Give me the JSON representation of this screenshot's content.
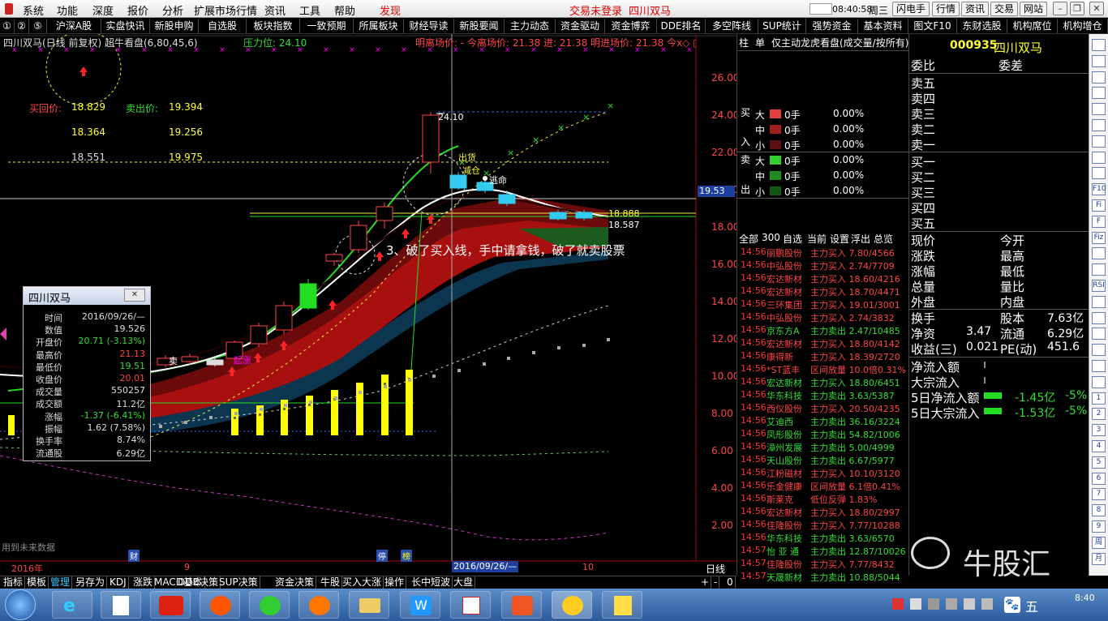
{
  "menu": {
    "items": [
      "系统",
      "功能",
      "深度",
      "报价",
      "分析",
      "扩展市场行情",
      "资讯",
      "工具",
      "帮助"
    ],
    "discover": "发现",
    "login_status": "交易未登录",
    "stock_title": "四川双马",
    "clock": "08:40:58",
    "weekday": "周三",
    "buttons": [
      "闪电手",
      "行情",
      "资讯",
      "交易",
      "网站"
    ]
  },
  "tabs": [
    "①",
    "②",
    "⑤",
    "沪深A股",
    "实盘快讯",
    "新股申购",
    "自选股",
    "板块指数",
    "一致预期",
    "所属板块",
    "财经导读",
    "新股要闻",
    "主力动态",
    "资金驱动",
    "资金博弈",
    "DDE排名",
    "多空阵线",
    "SUP统计",
    "强势资金",
    "基本资料",
    "图文F10",
    "东财选股",
    "机构席位",
    "机构增仓"
  ],
  "chart": {
    "header": {
      "name": "四川双马(日线 前复权) 超牛看盘(6,80,45,6)",
      "pressure": "压力位: 24.10",
      "signal": "明离场价: - 今离场价: 21.38 进: 21.38 明进场价: 21.38 今x◇ □"
    },
    "prices": [
      {
        "label": "买回价:",
        "buy": "18.829",
        "sell_label": "卖出价:",
        "sell": "19.394"
      },
      {
        "label": "",
        "buy": "18.364",
        "sell_label": "",
        "sell": "19.256"
      },
      {
        "label": "",
        "buy": "18.551",
        "sell_label": "",
        "sell": "19.975"
      }
    ],
    "price_axis": [
      "26.00",
      "24.00",
      "22.00",
      "20.00",
      "18.00",
      "16.00",
      "14.00",
      "12.00",
      "10.00",
      "8.00",
      "6.00",
      "4.00",
      "2.00"
    ],
    "cursor_price": "19.53",
    "annotation": "3、破了买入线，手中请拿钱，破了就卖股票",
    "labels": {
      "high": "24.10",
      "right1": "18.888",
      "right2": "18.587",
      "chu": "出货",
      "jian": "减仓",
      "tao": "逃命",
      "qi": "起涨",
      "mai": "卖",
      "watermark": "用到未来数据"
    },
    "date_axis": {
      "year": "2016年",
      "m9": "9",
      "m10": "10",
      "cursor_date": "2016/09/26/—",
      "cai1": "财",
      "cai2": "停",
      "cai3": "榜",
      "period": "日线"
    }
  },
  "infobox": {
    "title": "四川双马",
    "close": "✕",
    "rows": [
      {
        "k": "时间",
        "v": "2016/09/26/—",
        "c": "#ddd"
      },
      {
        "k": "数值",
        "v": "19.526",
        "c": "#ddd"
      },
      {
        "k": "开盘价",
        "v": "20.71 (-3.13%)",
        "c": "#3d3"
      },
      {
        "k": "最高价",
        "v": "21.13",
        "c": "#f44"
      },
      {
        "k": "最低价",
        "v": "19.51",
        "c": "#3d3"
      },
      {
        "k": "收盘价",
        "v": "20.01",
        "c": "#f44"
      },
      {
        "k": "成交量",
        "v": "550257",
        "c": "#ddd"
      },
      {
        "k": "成交额",
        "v": "11.2亿",
        "c": "#ddd"
      },
      {
        "k": "涨幅",
        "v": "-1.37 (-6.41%)",
        "c": "#3d3"
      },
      {
        "k": "振幅",
        "v": "1.62 (7.58%)",
        "c": "#ddd"
      },
      {
        "k": "换手率",
        "v": "8.74%",
        "c": "#ddd"
      },
      {
        "k": "流通股",
        "v": "6.29亿",
        "c": "#ddd"
      }
    ]
  },
  "mid": {
    "tabs": [
      "柱",
      "单",
      "仅主动",
      "龙虎看盘(成交量/按所有)"
    ],
    "flow_sides": [
      "买",
      "入",
      "卖",
      "出"
    ],
    "flow": [
      {
        "size": "大",
        "vol": "0手",
        "pct": "0.00%",
        "color": "#e04040"
      },
      {
        "size": "中",
        "vol": "0手",
        "pct": "0.00%",
        "color": "#a01e1e"
      },
      {
        "size": "小",
        "vol": "0手",
        "pct": "0.00%",
        "color": "#5a1010"
      },
      {
        "size": "大",
        "vol": "0手",
        "pct": "0.00%",
        "color": "#33cc33"
      },
      {
        "size": "中",
        "vol": "0手",
        "pct": "0.00%",
        "color": "#1e8c1e"
      },
      {
        "size": "小",
        "vol": "0手",
        "pct": "0.00%",
        "color": "#125812"
      }
    ],
    "filter": [
      "全部",
      "300",
      "自选",
      "当前",
      "设置",
      "浮出",
      "总览"
    ],
    "ticker": [
      {
        "t": "14:56",
        "n": "丽鹏股份",
        "d": "主力买入 7.80/4566",
        "c": "#f44"
      },
      {
        "t": "14:56",
        "n": "中弘股份",
        "d": "主力买入 2.74/7709",
        "c": "#f44"
      },
      {
        "t": "14:56",
        "n": "宏达新材",
        "d": "主力买入 18.60/4216",
        "c": "#f44"
      },
      {
        "t": "14:56",
        "n": "宏达新材",
        "d": "主力买入 18.70/4471",
        "c": "#f44"
      },
      {
        "t": "14:56",
        "n": "三环集团",
        "d": "主力买入 19.01/3001",
        "c": "#f44"
      },
      {
        "t": "14:56",
        "n": "中弘股份",
        "d": "主力买入 2.74/3832",
        "c": "#f44"
      },
      {
        "t": "14:56",
        "n": "京东方A",
        "d": "主力卖出 2.47/10485",
        "c": "#3d3"
      },
      {
        "t": "14:56",
        "n": "宏达新材",
        "d": "主力买入 18.80/4142",
        "c": "#f44"
      },
      {
        "t": "14:56",
        "n": "康得新",
        "d": "主力买入 18.39/2720",
        "c": "#f44"
      },
      {
        "t": "14:56",
        "n": "*ST蓝丰",
        "d": "区间放量 10.0倍0.31%",
        "c": "#f44"
      },
      {
        "t": "14:56",
        "n": "宏达新材",
        "d": "主力买入 18.80/6451",
        "c": "#3d3"
      },
      {
        "t": "14:56",
        "n": "华东科技",
        "d": "主力卖出 3.63/5387",
        "c": "#3d3"
      },
      {
        "t": "14:56",
        "n": "西仪股份",
        "d": "主力买入 20.50/4235",
        "c": "#f44"
      },
      {
        "t": "14:56",
        "n": "艾迪西",
        "d": "主力卖出 36.16/3224",
        "c": "#3d3"
      },
      {
        "t": "14:56",
        "n": "凤形股份",
        "d": "主力卖出 54.82/1006",
        "c": "#3d3"
      },
      {
        "t": "14:56",
        "n": "漳州发展",
        "d": "主力卖出 5.00/4999",
        "c": "#3d3"
      },
      {
        "t": "14:56",
        "n": "天山股份",
        "d": "主力卖出 6.67/5977",
        "c": "#3d3"
      },
      {
        "t": "14:56",
        "n": "江粉磁材",
        "d": "主力买入 10.10/3120",
        "c": "#f44"
      },
      {
        "t": "14:56",
        "n": "乐金健康",
        "d": "区间放量 6.1倍0.41%",
        "c": "#f44"
      },
      {
        "t": "14:56",
        "n": "斯莱克",
        "d": "低位反弹 1.83%",
        "c": "#f44"
      },
      {
        "t": "14:56",
        "n": "宏达新材",
        "d": "主力买入 18.80/2997",
        "c": "#f44"
      },
      {
        "t": "14:56",
        "n": "佳隆股份",
        "d": "主力买入 7.77/10288",
        "c": "#f44"
      },
      {
        "t": "14:56",
        "n": "华东科技",
        "d": "主力卖出 3.63/6570",
        "c": "#3d3"
      },
      {
        "t": "14:57",
        "n": "怡 亚 通",
        "d": "主力卖出 12.87/10026",
        "c": "#3d3"
      },
      {
        "t": "14:57",
        "n": "佳隆股份",
        "d": "主力买入 7.77/8432",
        "c": "#f44"
      },
      {
        "t": "14:57",
        "n": "天晟新材",
        "d": "主力卖出 10.88/5044",
        "c": "#3d3"
      }
    ]
  },
  "right": {
    "code": "000935",
    "name": "四川双马",
    "book_header": [
      "委比",
      "委差"
    ],
    "sells": [
      "卖五",
      "卖四",
      "卖三",
      "卖二",
      "卖一"
    ],
    "buys": [
      "买一",
      "买二",
      "买三",
      "买四",
      "买五"
    ],
    "stats": [
      [
        "现价",
        "今开"
      ],
      [
        "涨跌",
        "最高"
      ],
      [
        "涨幅",
        "最低"
      ],
      [
        "总量",
        "量比"
      ],
      [
        "外盘",
        "内盘"
      ]
    ],
    "fund": [
      {
        "k": "换手",
        "k2": "股本",
        "v2": "7.63亿"
      },
      {
        "k": "净资",
        "v": "3.47",
        "k2": "流通",
        "v2": "6.29亿"
      },
      {
        "k": "收益(三)",
        "v": "0.021",
        "k2": "PE(动)",
        "v2": "451.6"
      }
    ],
    "flows": [
      {
        "k": "净流入额"
      },
      {
        "k": "大宗流入"
      },
      {
        "k": "5日净流入额",
        "v": "-1.45亿",
        "p": "-5%"
      },
      {
        "k": "5日大宗流入",
        "v": "-1.53亿",
        "p": "-5%"
      }
    ],
    "watermark": "牛股汇"
  },
  "bottom_tabs": [
    "指标",
    "模板",
    "管理",
    "另存为",
    "KDJ",
    "涨跌",
    "MACD基本",
    "DDE决策",
    "SUP决策",
    "资金决策",
    "牛股",
    "买入大涨",
    "操作",
    "长中短波",
    "大盘"
  ],
  "bottom_nav": [
    "+",
    "-",
    "0"
  ],
  "right_tools": [
    "",
    "",
    "",
    "",
    "",
    "",
    "",
    "",
    "",
    "F10",
    "Fi",
    "F",
    "Fiz",
    "",
    "",
    "RSI",
    "",
    "",
    "",
    "",
    "",
    "",
    "1",
    "2",
    "3",
    "4",
    "5",
    "6",
    "7",
    "8",
    "9",
    "周",
    "月"
  ],
  "taskbar": {
    "time": "8:40",
    "ime": "五"
  }
}
